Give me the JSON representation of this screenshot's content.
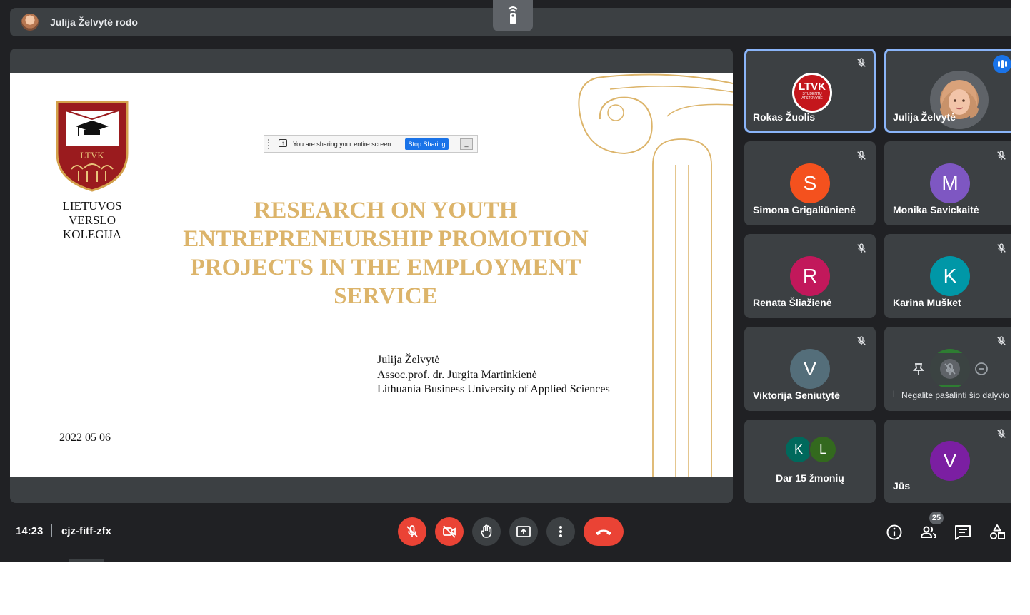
{
  "banner": {
    "presenter_text": "Julija Želvytė rodo"
  },
  "slide": {
    "logo_badge_text": "LTVK",
    "logo_lines": [
      "LIETUVOS",
      "VERSLO",
      "KOLEGIJA"
    ],
    "title": "RESEARCH ON YOUTH ENTREPRENEURSHIP PROMOTION PROJECTS IN THE EMPLOYMENT SERVICE",
    "authors": [
      "Julija Želvytė",
      "Assoc.prof. dr. Jurgita Martinkienė",
      "Lithuania Business University of Applied Sciences"
    ],
    "date": "2022 05 06",
    "title_color": "#dcb46a"
  },
  "share_bar": {
    "message": "You are sharing your entire screen.",
    "stop_label": "Stop Sharing",
    "hide_label": "_"
  },
  "participants": [
    {
      "name": "Rokas Žuolis",
      "badge_top": "LTVK",
      "badge_bottom": "STUDENTŲ ATSTOVYBĖ",
      "speaking": true,
      "muted": true
    },
    {
      "name": "Julija Želvytė",
      "speaking": true,
      "muted": false
    },
    {
      "name": "Simona Grigaliūnienė",
      "initial": "S",
      "color": "#f4511e",
      "muted": true
    },
    {
      "name": "Monika Savickaitė",
      "initial": "M",
      "color": "#7e57c2",
      "muted": true
    },
    {
      "name": "Renata Šliažienė",
      "initial": "R",
      "color": "#c2185b",
      "muted": true
    },
    {
      "name": "Karina Mušket",
      "initial": "K",
      "color": "#0097a7",
      "muted": true
    },
    {
      "name": "Viktorija Seniutytė",
      "initial": "V",
      "color": "#546e7a",
      "muted": true
    },
    {
      "name": "L",
      "tooltip": "Negalite pašalinti šio dalyvio",
      "muted": true
    },
    {
      "name": "Dar 15 žmonių",
      "initials": [
        "K",
        "L"
      ],
      "colors": [
        "#00695c",
        "#33691e"
      ]
    },
    {
      "name": "Jūs",
      "initial": "V",
      "color": "#7b1fa2",
      "muted": true
    }
  ],
  "bottom_bar": {
    "time": "14:23",
    "meeting_code": "cjz-fitf-zfx",
    "participant_count": "25"
  },
  "icons": [
    "present-icon",
    "mic-off-icon",
    "camera-off-icon",
    "raise-hand-icon",
    "present-screen-icon",
    "more-options-icon",
    "hang-up-icon",
    "info-icon",
    "people-icon",
    "chat-icon",
    "activities-icon",
    "pin-icon",
    "remove-icon",
    "talking-indicator-icon"
  ]
}
